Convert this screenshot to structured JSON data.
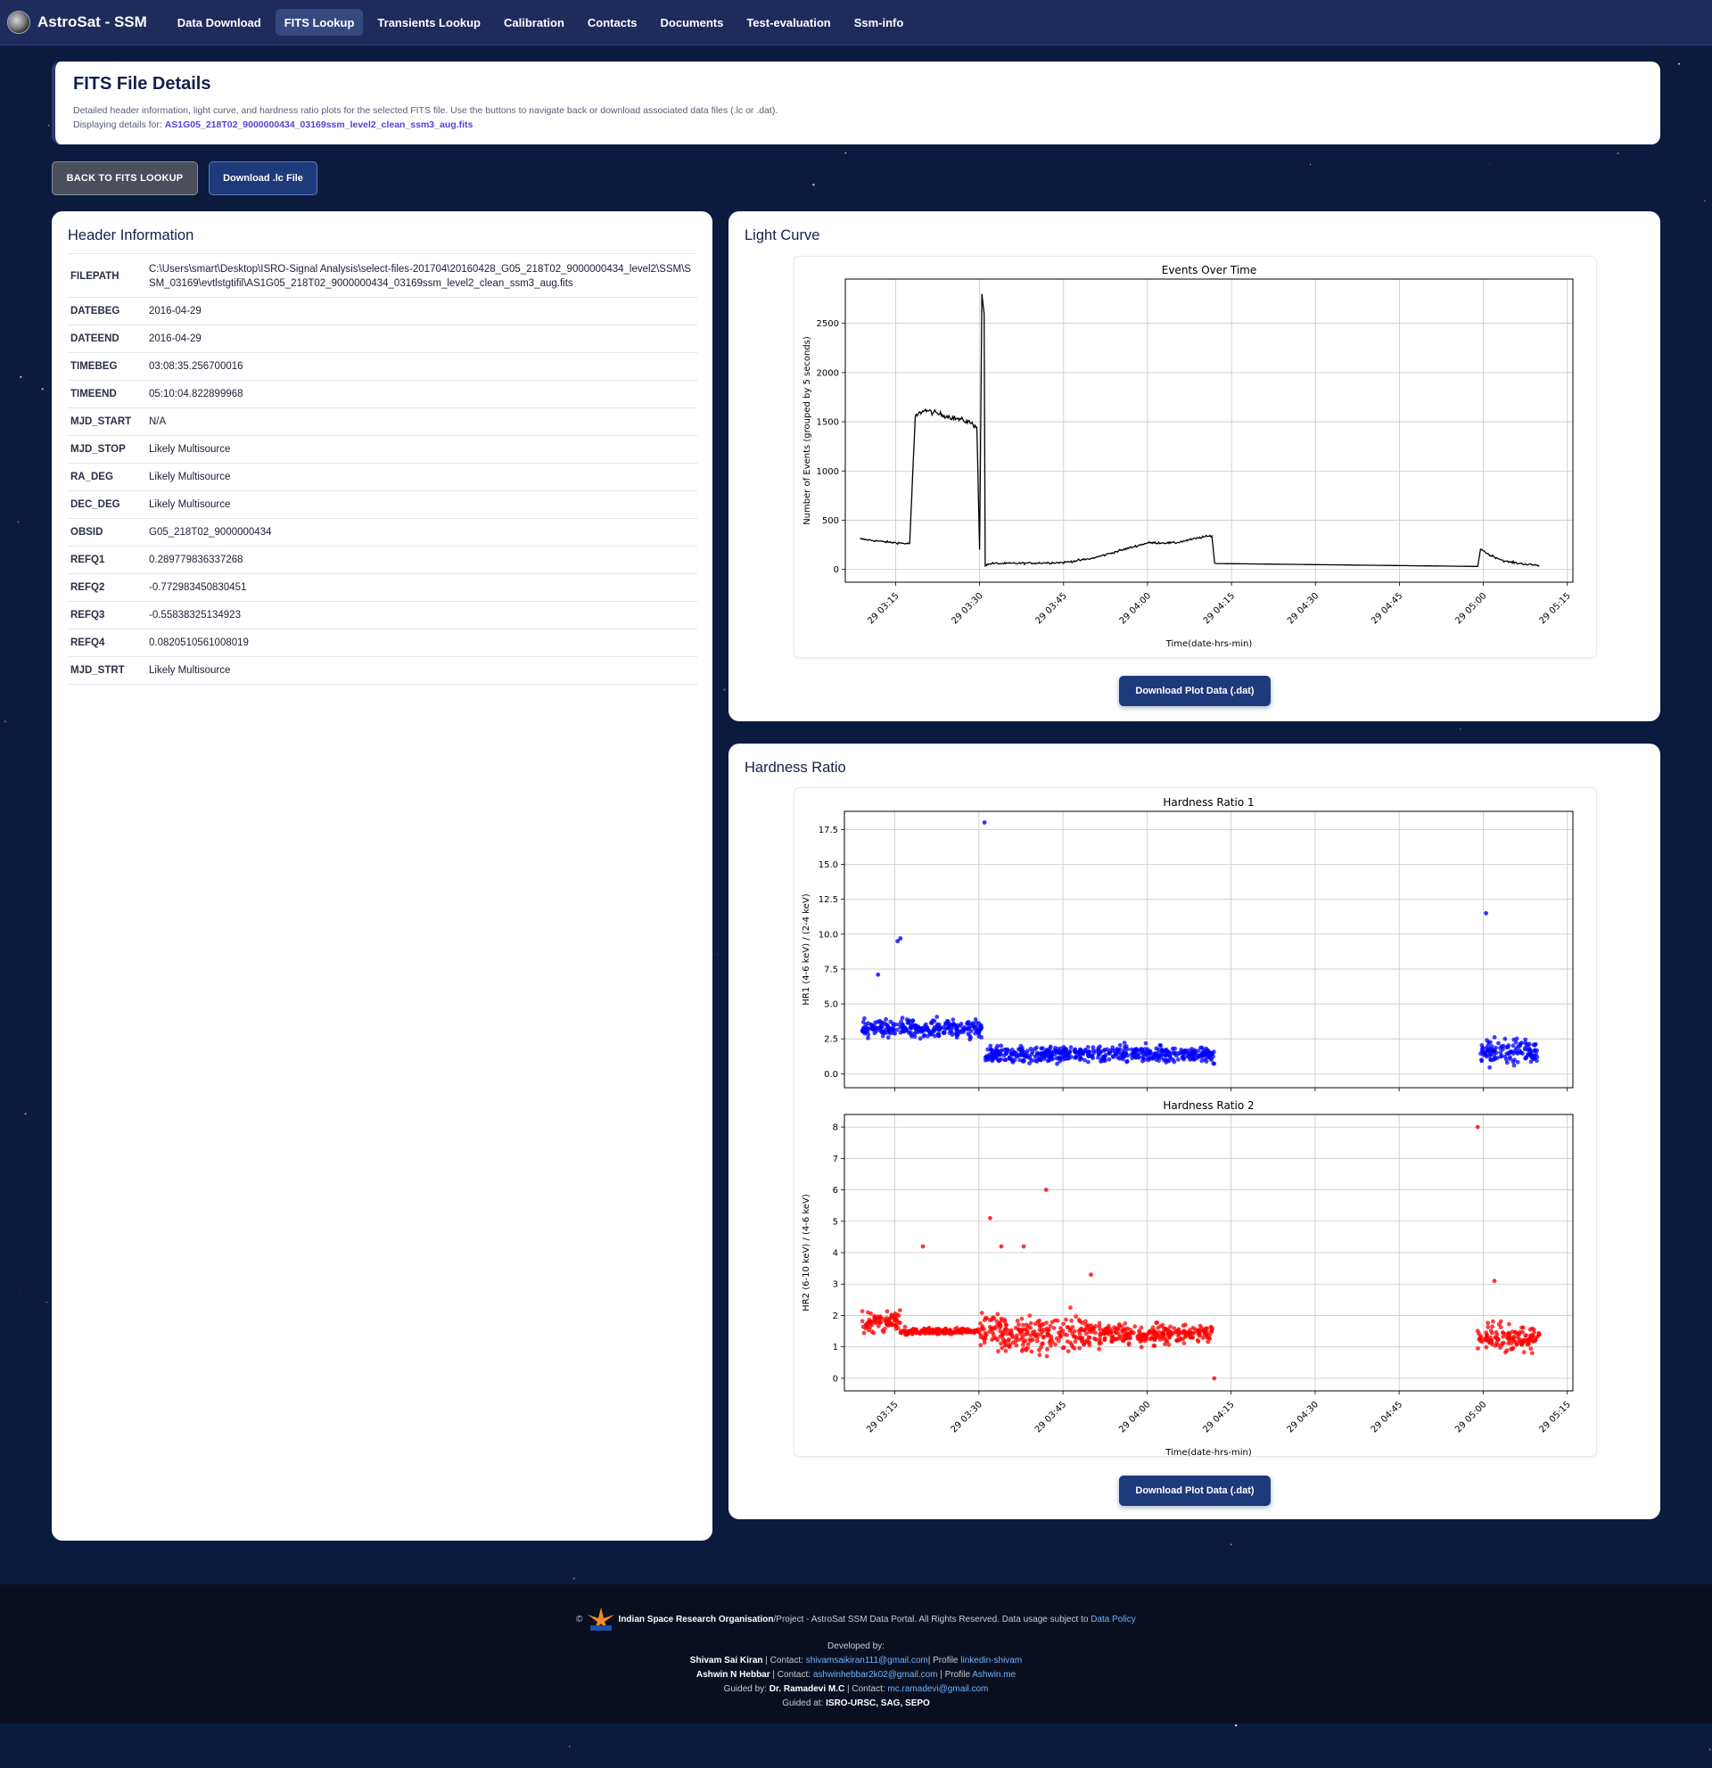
{
  "nav": {
    "brand": "AstroSat - SSM",
    "items": [
      "Data Download",
      "FITS Lookup",
      "Transients Lookup",
      "Calibration",
      "Contacts",
      "Documents",
      "Test-evaluation",
      "Ssm-info"
    ],
    "active_index": 1
  },
  "title_card": {
    "title": "FITS File Details",
    "description": "Detailed header information, light curve, and hardness ratio plots for the selected FITS file. Use the buttons to navigate back or download associated data files (.lc or .dat).",
    "displaying_prefix": "Displaying details for:",
    "filename": "AS1G05_218T02_9000000434_03169ssm_level2_clean_ssm3_aug.fits"
  },
  "buttons": {
    "back": "BACK TO FITS LOOKUP",
    "download_lc": "Download .lc File",
    "download_plot": "Download Plot Data (.dat)"
  },
  "header_info": {
    "title": "Header Information",
    "rows": [
      {
        "key": "FILEPATH",
        "value": "C:\\Users\\smart\\Desktop\\ISRO-Signal Analysis\\select-files-201704\\20160428_G05_218T02_9000000434_level2\\SSM\\SSM_03169\\evtlstgtifil\\AS1G05_218T02_9000000434_03169ssm_level2_clean_ssm3_aug.fits"
      },
      {
        "key": "DATEBEG",
        "value": "2016-04-29"
      },
      {
        "key": "DATEEND",
        "value": "2016-04-29"
      },
      {
        "key": "TIMEBEG",
        "value": "03:08:35.256700016"
      },
      {
        "key": "TIMEEND",
        "value": "05:10:04.822899968"
      },
      {
        "key": "MJD_START",
        "value": "N/A"
      },
      {
        "key": "MJD_STOP",
        "value": "Likely Multisource"
      },
      {
        "key": "RA_DEG",
        "value": "Likely Multisource"
      },
      {
        "key": "DEC_DEG",
        "value": "Likely Multisource"
      },
      {
        "key": "OBSID",
        "value": "G05_218T02_9000000434"
      },
      {
        "key": "REFQ1",
        "value": "0.289779836337268"
      },
      {
        "key": "REFQ2",
        "value": "-0.772983450830451"
      },
      {
        "key": "REFQ3",
        "value": "-0.55838325134923"
      },
      {
        "key": "REFQ4",
        "value": "0.0820510561008019"
      },
      {
        "key": "MJD_STRT",
        "value": "Likely Multisource"
      }
    ]
  },
  "light_curve": {
    "section_title": "Light Curve"
  },
  "hardness": {
    "section_title": "Hardness Ratio"
  },
  "chart_data": [
    {
      "type": "line",
      "title": "Events Over Time",
      "xlabel": "Time(date-hrs-min)",
      "ylabel": "Number of Events (grouped by 5 seconds)",
      "x_ticks": [
        "29 03:15",
        "29 03:30",
        "29 03:45",
        "29 04:00",
        "29 04:15",
        "29 04:30",
        "29 04:45",
        "29 05:00",
        "29 05:15"
      ],
      "y_ticks": [
        0,
        500,
        1000,
        1500,
        2000,
        2500
      ],
      "xlim": [
        "03:06",
        "05:16"
      ],
      "ylim": [
        -130,
        2950
      ],
      "grid": true,
      "color": "#000000",
      "series": [
        {
          "x": [
            "03:08.6",
            "03:13",
            "03:17.5"
          ],
          "y": [
            310,
            280,
            260
          ]
        },
        {
          "x": [
            "03:17.5",
            "03:18.5",
            "03:20",
            "03:24",
            "03:28",
            "03:29.5"
          ],
          "y": [
            260,
            1550,
            1620,
            1560,
            1500,
            1450
          ]
        },
        {
          "x": [
            "03:29.5",
            "03:30",
            "03:30.4",
            "03:30.8",
            "03:31",
            "03:32",
            "03:35",
            "03:45",
            "03:50",
            "03:55",
            "04:00",
            "04:05",
            "04:10",
            "04:11.5",
            "04:12"
          ],
          "y": [
            1450,
            200,
            2800,
            2600,
            40,
            60,
            60,
            70,
            110,
            190,
            270,
            270,
            330,
            340,
            60
          ]
        },
        {
          "x": [
            "04:12",
            "04:59"
          ],
          "y": [
            60,
            30
          ]
        },
        {
          "x": [
            "04:59",
            "04:59.5",
            "05:01",
            "05:04",
            "05:08",
            "05:10"
          ],
          "y": [
            30,
            210,
            150,
            80,
            50,
            40
          ]
        }
      ]
    },
    {
      "type": "scatter",
      "title": "Hardness Ratio 1",
      "xlabel": "",
      "ylabel": "HR1 (4-6 keV) / (2-4 keV)",
      "y_ticks": [
        0.0,
        2.5,
        5.0,
        7.5,
        10.0,
        12.5,
        15.0,
        17.5
      ],
      "ylim": [
        -1.0,
        18.8
      ],
      "grid": true,
      "color": "#0000ff",
      "clusters": [
        {
          "x_range": [
            "03:09",
            "03:30.5"
          ],
          "y_mean": 3.2,
          "y_spread": 0.7
        },
        {
          "x_range": [
            "03:31",
            "04:12"
          ],
          "y_mean": 1.4,
          "y_spread": 0.6
        },
        {
          "x_range": [
            "04:59.5",
            "05:10"
          ],
          "y_mean": 1.6,
          "y_spread": 0.9
        }
      ],
      "outliers": [
        {
          "x": "03:12",
          "y": 7.1
        },
        {
          "x": "03:15.5",
          "y": 9.5
        },
        {
          "x": "03:16",
          "y": 9.7
        },
        {
          "x": "03:31",
          "y": 18.0
        },
        {
          "x": "05:00.5",
          "y": 11.5
        }
      ]
    },
    {
      "type": "scatter",
      "title": "Hardness Ratio 2",
      "xlabel": "Time(date-hrs-min)",
      "ylabel": "HR2 (6-10 keV) / (4-6 keV)",
      "x_ticks": [
        "29 03:15",
        "29 03:30",
        "29 03:45",
        "29 04:00",
        "29 04:15",
        "29 04:30",
        "29 04:45",
        "29 05:00",
        "29 05:15"
      ],
      "y_ticks": [
        0,
        1,
        2,
        3,
        4,
        5,
        6,
        7,
        8
      ],
      "ylim": [
        -0.4,
        8.4
      ],
      "grid": true,
      "color": "#ff0000",
      "clusters": [
        {
          "x_range": [
            "03:09",
            "03:16"
          ],
          "y_mean": 1.8,
          "y_spread": 0.35
        },
        {
          "x_range": [
            "03:16",
            "03:30"
          ],
          "y_mean": 1.5,
          "y_spread": 0.1
        },
        {
          "x_range": [
            "03:30",
            "03:52"
          ],
          "y_mean": 1.4,
          "y_spread": 0.6
        },
        {
          "x_range": [
            "03:52",
            "04:12"
          ],
          "y_mean": 1.4,
          "y_spread": 0.35
        },
        {
          "x_range": [
            "04:59",
            "05:10"
          ],
          "y_mean": 1.3,
          "y_spread": 0.45
        }
      ],
      "outliers": [
        {
          "x": "03:20",
          "y": 4.2
        },
        {
          "x": "03:32",
          "y": 5.1
        },
        {
          "x": "03:34",
          "y": 4.2
        },
        {
          "x": "03:38",
          "y": 4.2
        },
        {
          "x": "03:42",
          "y": 6.0
        },
        {
          "x": "03:50",
          "y": 3.3
        },
        {
          "x": "04:12",
          "y": 0.0
        },
        {
          "x": "04:59",
          "y": 8.0
        },
        {
          "x": "05:02",
          "y": 3.1
        }
      ]
    }
  ],
  "footer": {
    "copyright": "©",
    "org": "Indian Space Research Organisation",
    "rights": "/Project - AstroSat SSM Data Portal. All Rights Reserved. Data usage subject to",
    "policy_link": "Data Policy",
    "developed_by": "Developed by:",
    "dev1_name": "Shivam Sai Kiran",
    "dev1_contact_label": "| Contact:",
    "dev1_email": "shivamsaikiran111@gmail.com",
    "dev1_profile_label": "| Profile",
    "dev1_profile": "linkedin-shivam",
    "dev2_name": "Ashwin N Hebbar",
    "dev2_contact_label": "| Contact:",
    "dev2_email": "ashwinhebbar2k02@gmail.com",
    "dev2_profile_label": "| Profile",
    "dev2_profile": "Ashwin.me",
    "guided_label": "Guided by:",
    "guide_name": "Dr. Ramadevi M.C",
    "guide_contact_label": "| Contact:",
    "guide_email": "mc.ramadevi@gmail.com",
    "guided_at_label": "Guided at:",
    "guided_at": "ISRO-URSC, SAG, SEPO"
  }
}
